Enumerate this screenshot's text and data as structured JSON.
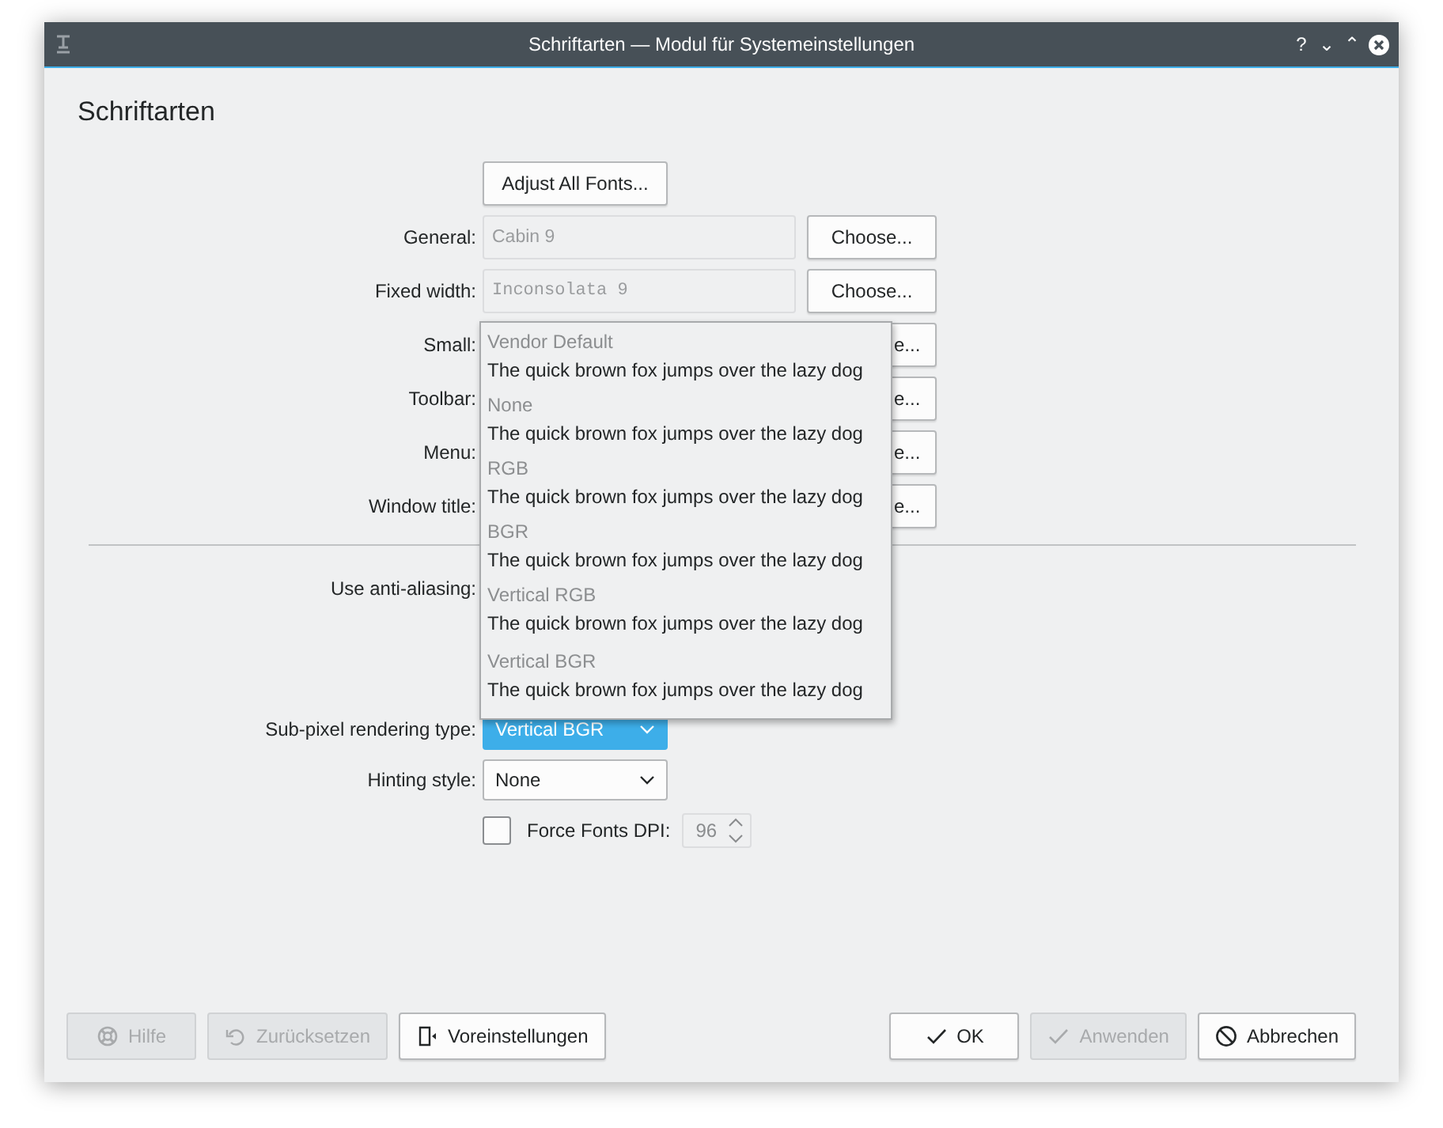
{
  "window": {
    "title": "Schriftarten — Modul für Systemeinstellungen",
    "controls": [
      "?",
      "⌄",
      "⌃"
    ]
  },
  "heading": "Schriftarten",
  "adjust_button": "Adjust All Fonts...",
  "font_rows": [
    {
      "kind": "field",
      "label": "General:",
      "value": "Cabin 9",
      "mono": false,
      "button": "Choose..."
    },
    {
      "kind": "field",
      "label": "Fixed width:",
      "value": "Inconsolata 9",
      "mono": true,
      "button": "Choose..."
    },
    {
      "kind": "covered",
      "label": "Small:",
      "button": "e..."
    },
    {
      "kind": "covered",
      "label": "Toolbar:",
      "button": "e..."
    },
    {
      "kind": "covered",
      "label": "Menu:",
      "button": "e..."
    },
    {
      "kind": "covered",
      "label": "Window title:",
      "button": "e..."
    }
  ],
  "antialiasing": {
    "label": "Use anti-aliasing:"
  },
  "subpixel": {
    "label": "Sub-pixel rendering type:",
    "value": "Vertical BGR",
    "open": true,
    "options": [
      {
        "name": "Vendor Default",
        "sample": "The quick brown fox jumps over the lazy dog"
      },
      {
        "name": "None",
        "sample": "The quick brown fox jumps over the lazy dog"
      },
      {
        "name": "RGB",
        "sample": "The quick brown fox jumps over the lazy dog"
      },
      {
        "name": "BGR",
        "sample": "The quick brown fox jumps over the lazy dog"
      },
      {
        "name": "Vertical RGB",
        "sample": "The quick brown fox jumps over the lazy dog"
      },
      {
        "name": "Vertical BGR",
        "sample": "The quick brown fox jumps over the lazy dog"
      }
    ]
  },
  "hinting": {
    "label": "Hinting style:",
    "value": "None"
  },
  "force_dpi": {
    "label": "Force Fonts DPI:",
    "checked": false,
    "value": "96",
    "disabled": true
  },
  "buttons_left": [
    {
      "label": "Hilfe",
      "kind": "lifebuoy",
      "disabled": true
    },
    {
      "label": "Zurücksetzen",
      "kind": "undo",
      "disabled": true
    },
    {
      "label": "Voreinstellungen",
      "kind": "document",
      "disabled": false
    }
  ],
  "buttons_right": [
    {
      "label": "OK",
      "kind": "check",
      "disabled": false
    },
    {
      "label": "Anwenden",
      "kind": "check",
      "disabled": true
    },
    {
      "label": "Abbrechen",
      "kind": "cancel",
      "disabled": false
    }
  ]
}
